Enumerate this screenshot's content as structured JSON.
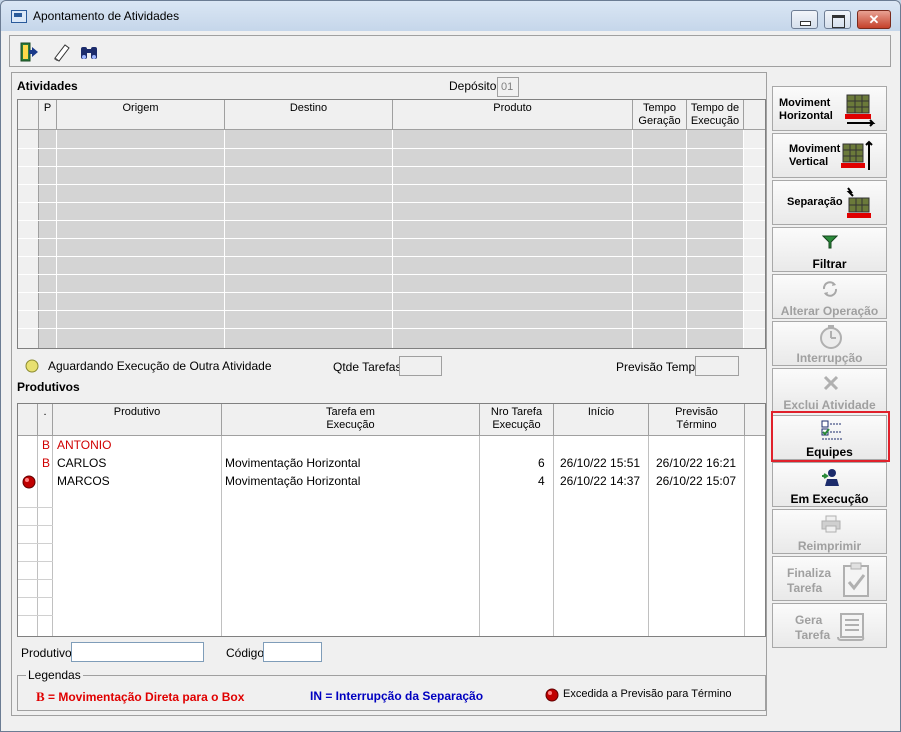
{
  "window": {
    "title": "Apontamento de Atividades",
    "close_glyph": "✕"
  },
  "toolbar": {
    "icons": [
      "exit-icon",
      "eraser-icon",
      "binoculars-icon"
    ]
  },
  "atividades": {
    "title": "Atividades",
    "deposito_label": "Depósito",
    "deposito_value": "01",
    "columns": [
      "P",
      "Origem",
      "Destino",
      "Produto",
      "Tempo Geração",
      "Tempo de Execução"
    ],
    "col_p": "P",
    "col_origem": "Origem",
    "col_destino": "Destino",
    "col_produto": "Produto",
    "col_tempo_geracao_1": "Tempo",
    "col_tempo_geracao_2": "Geração",
    "col_tempo_execucao_1": "Tempo de",
    "col_tempo_execucao_2": "Execução"
  },
  "status_line": {
    "aguardando": "Aguardando Execução de Outra Atividade",
    "qtde_tarefas_label": "Qtde Tarefas",
    "previsao_tempo_label": "Previsão Tempo"
  },
  "produtivos": {
    "title": "Produtivos",
    "col_dot": ".",
    "col_produtivo": "Produtivo",
    "col_tarefa_1": "Tarefa em",
    "col_tarefa_2": "Execução",
    "col_nro_1": "Nro Tarefa",
    "col_nro_2": "Execução",
    "col_inicio": "Início",
    "col_previsao_1": "Previsão",
    "col_previsao_2": "Término",
    "rows": [
      {
        "flag": "B",
        "produtivo": "ANTONIO",
        "tarefa": "",
        "nro": "",
        "inicio": "",
        "previsao": "",
        "red": true,
        "exceeded": false
      },
      {
        "flag": "B",
        "produtivo": "CARLOS",
        "tarefa": "Movimentação Horizontal",
        "nro": "6",
        "inicio": "26/10/22  15:51",
        "previsao": "26/10/22  16:21",
        "red": false,
        "exceeded": false
      },
      {
        "flag": "",
        "produtivo": "MARCOS",
        "tarefa": "Movimentação Horizontal",
        "nro": "4",
        "inicio": "26/10/22  14:37",
        "previsao": "26/10/22  15:07",
        "red": false,
        "exceeded": true
      }
    ]
  },
  "filters": {
    "produtivo_label": "Produtivo",
    "codigo_label": "Código",
    "produtivo_value": "",
    "codigo_value": ""
  },
  "legendas": {
    "title": "Legendas",
    "b_symbol": "B",
    "b_text": "= Movimentação Direta para o Box",
    "in_text": "IN = Interrupção da Separação",
    "exceeded_text": "Excedida a Previsão para Término"
  },
  "side_buttons": {
    "mov_horizontal_1": "Moviment",
    "mov_horizontal_2": "Horizontal",
    "mov_vertical_1": "Moviment",
    "mov_vertical_2": "Vertical",
    "separacao": "Separação",
    "filtrar": "Filtrar",
    "alterar_operacao": "Alterar Operação",
    "interrupcao": "Interrupção",
    "exclui_atividade": "Exclui Atividade",
    "equipes": "Equipes",
    "em_execucao": "Em Execução",
    "reimprimir": "Reimprimir",
    "finaliza_1": "Finaliza",
    "finaliza_2": "Tarefa",
    "gera_1": "Gera",
    "gera_2": "Tarefa"
  },
  "colors": {
    "accent_red": "#e0212b",
    "legend_red": "#e00000",
    "legend_blue": "#0000c0"
  }
}
